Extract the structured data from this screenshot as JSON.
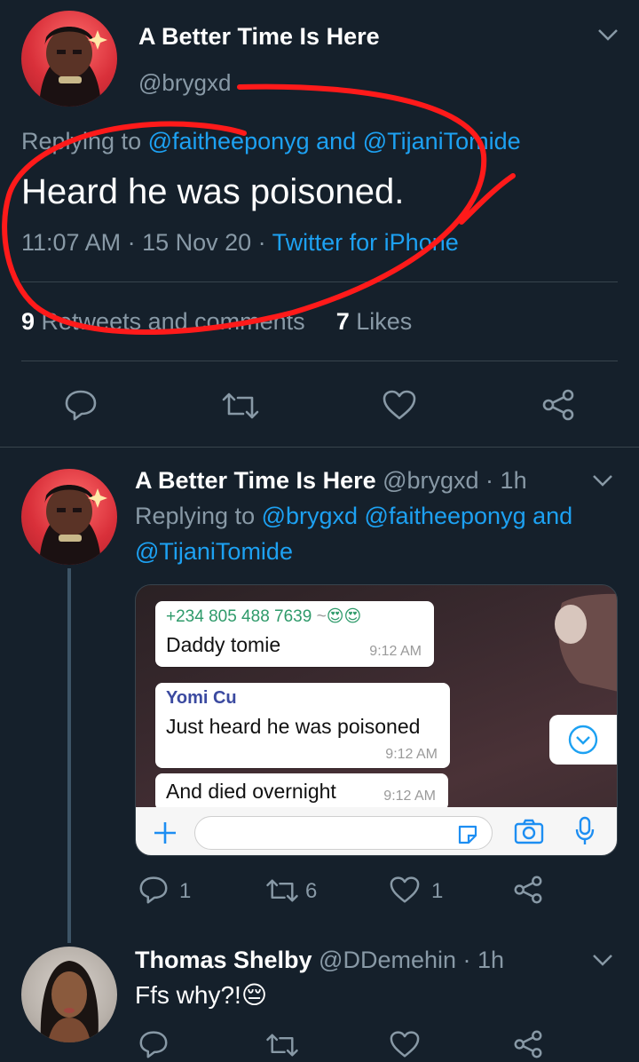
{
  "main_tweet": {
    "display_name": "A Better Time Is Here",
    "handle": "@brygxd",
    "replying_prefix": "Replying to ",
    "replying_user1": "@faitheeponyg",
    "replying_and": " and ",
    "replying_user2": "@TijaniTomide",
    "text": "Heard he was poisoned.",
    "timestamp": "11:07 AM · 15 Nov 20 · ",
    "source": "Twitter for iPhone",
    "retweets_count": "9",
    "retweets_label": " Retweets and comments",
    "likes_count": "7",
    "likes_label": " Likes"
  },
  "reply1": {
    "display_name": "A Better Time Is Here",
    "handle_time": " @brygxd · 1h",
    "replying_prefix": "Replying to ",
    "replying_users_line1": "@brygxd @faitheeponyg",
    "replying_and": " and",
    "replying_users_line2": "@TijaniTomide",
    "reply_count": "1",
    "retweet_count": "6",
    "like_count": "1"
  },
  "whatsapp": {
    "msg1_sender": "+234 805 488 7639",
    "msg1_tilde": " ~",
    "msg1_emoji": "😍😍",
    "msg1_text": "Daddy tomie",
    "msg1_time": "9:12 AM",
    "msg2_sender": "Yomi Cu",
    "msg2_text": "Just heard he was poisoned",
    "msg2_time": "9:12 AM",
    "msg3_text": "And died overnight",
    "msg3_time": "9:12 AM"
  },
  "reply2": {
    "display_name": "Thomas Shelby",
    "handle_time": " @DDemehin · 1h",
    "text": "Ffs why?!",
    "emoji": "😔"
  },
  "colors": {
    "background": "#15202b",
    "accent": "#1da1f2",
    "secondary_text": "#8899a6",
    "annotation_circle": "#ff1a1a"
  }
}
